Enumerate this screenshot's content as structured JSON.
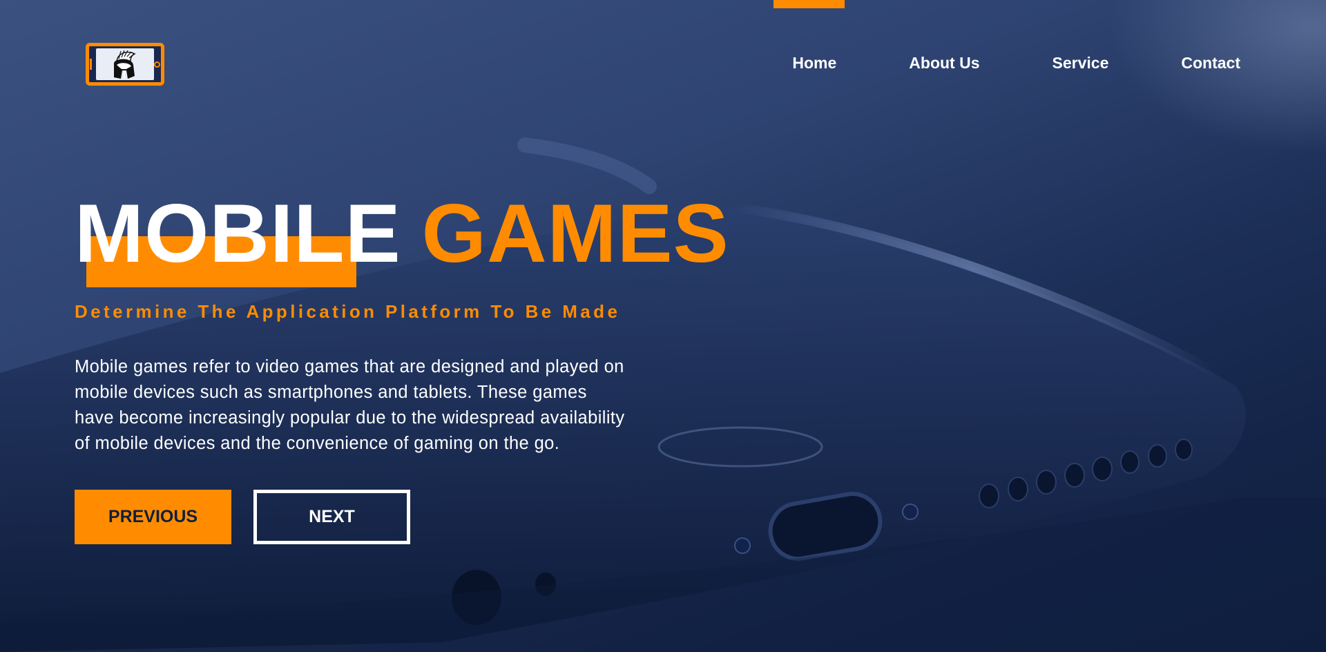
{
  "brand": {
    "logo_icon": "spartan-helmet-phone-logo",
    "accent_color": "#ff8c00",
    "background_color": "#1c2f57"
  },
  "nav": {
    "active_index": 0,
    "items": [
      {
        "label": "Home"
      },
      {
        "label": "About Us"
      },
      {
        "label": "Service"
      },
      {
        "label": "Contact"
      }
    ]
  },
  "hero": {
    "title_word1": "MOBILE",
    "title_word2": "GAMES",
    "subtitle": "Determine The Application Platform To Be Made",
    "description": "Mobile games refer to video games that are designed and played on mobile devices such as smartphones and tablets. These games have become increasingly popular due to the widespread availability of mobile devices and the convenience of gaming on the go.",
    "prev_label": "PREVIOUS",
    "next_label": "NEXT"
  }
}
